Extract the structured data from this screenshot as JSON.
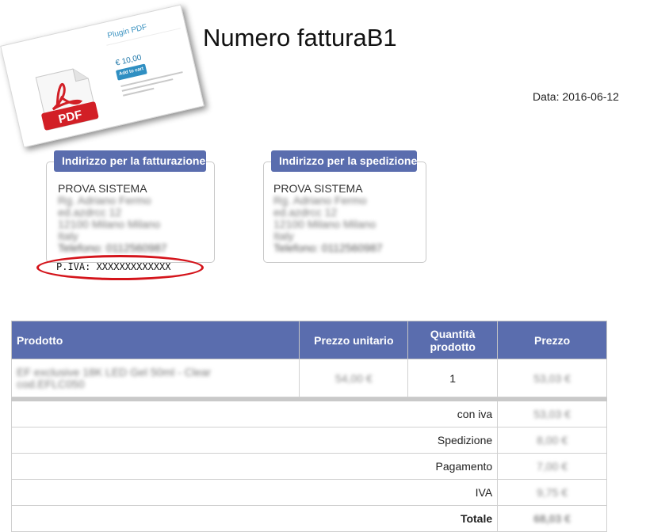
{
  "plugin_card": {
    "title": "Plugin PDF",
    "price": "€ 10,00",
    "button_label": "Add to cart",
    "icon": "pdf-file-icon",
    "icon_label": "PDF"
  },
  "invoice": {
    "title": "Numero fatturaB1",
    "date_label": "Data: 2016-06-12"
  },
  "billing": {
    "heading": "Indirizzo per la fatturazione",
    "name": "PROVA SISTEMA",
    "street": "Rg. Adriano Fermo",
    "line2": "ed.azdrcc 12",
    "city": "12100 Milano Milano",
    "country": "Italy",
    "phone": "Telefono: 0112560987",
    "vat": "P.IVA: XXXXXXXXXXXXX"
  },
  "shipping": {
    "heading": "Indirizzo per la spedizione",
    "name": "PROVA SISTEMA",
    "street": "Rg. Adriano Fermo",
    "line2": "ed.azdrcc 12",
    "city": "12100 Milano Milano",
    "country": "Italy",
    "phone": "Telefono: 0112560987"
  },
  "table": {
    "headers": {
      "product": "Prodotto",
      "unit_price": "Prezzo unitario",
      "quantity_line1": "Quantità",
      "quantity_line2": "prodotto",
      "price": "Prezzo"
    },
    "item": {
      "name_line1": "EF exclusive 18K LED Gel 50ml - Clear",
      "name_line2": "cod.EFLC050",
      "unit_price": "54,00 €",
      "quantity": "1",
      "price": "53,03 €"
    },
    "summary": [
      {
        "label": "con iva",
        "value": "53,03 €"
      },
      {
        "label": "Spedizione",
        "value": "8,00 €"
      },
      {
        "label": "Pagamento",
        "value": "7,00 €"
      },
      {
        "label": "IVA",
        "value": "9,75 €"
      },
      {
        "label": "Totale",
        "value": "68,03 €"
      }
    ]
  },
  "colors": {
    "header_blue": "#5a6dae",
    "vat_ellipse_red": "#d4141b",
    "pdf_red": "#d21f26"
  }
}
